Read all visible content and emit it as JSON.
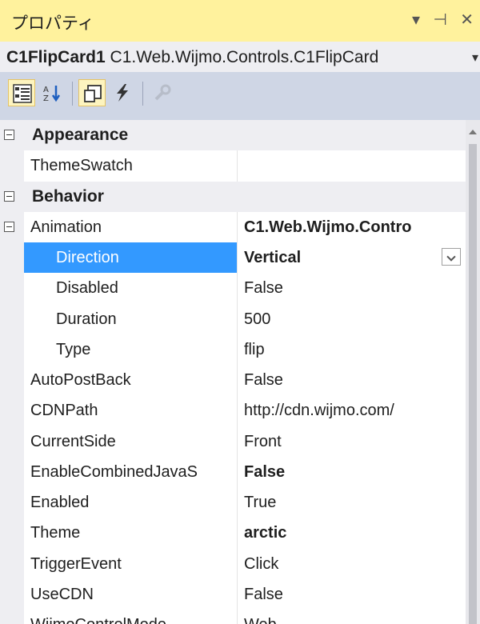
{
  "window": {
    "title": "プロパティ",
    "controls": [
      "▾",
      "⊣",
      "✕"
    ]
  },
  "object_selector": {
    "name": "C1FlipCard1",
    "type": "C1.Web.Wijmo.Controls.C1FlipCard",
    "dropdown": "▾"
  },
  "toolbar": {
    "buttons": [
      {
        "name": "categorized-icon",
        "active": true
      },
      {
        "name": "alphabetical-icon",
        "active": false
      },
      {
        "name": "properties-icon",
        "active": true
      },
      {
        "name": "events-icon",
        "active": false
      },
      {
        "name": "property-pages-icon",
        "active": false,
        "disabled": true
      }
    ]
  },
  "grid": {
    "rows": [
      {
        "kind": "category",
        "label": "Appearance"
      },
      {
        "kind": "prop",
        "name": "ThemeSwatch",
        "value": ""
      },
      {
        "kind": "category",
        "label": "Behavior"
      },
      {
        "kind": "prop",
        "name": "Animation",
        "value": "C1.Web.Wijmo.Contro",
        "bold": true,
        "expander": true
      },
      {
        "kind": "prop",
        "name": "Direction",
        "value": "Vertical",
        "bold": true,
        "indent": true,
        "selected": true,
        "dropdown": true
      },
      {
        "kind": "prop",
        "name": "Disabled",
        "value": "False",
        "indent": true
      },
      {
        "kind": "prop",
        "name": "Duration",
        "value": "500",
        "indent": true
      },
      {
        "kind": "prop",
        "name": "Type",
        "value": "flip",
        "indent": true
      },
      {
        "kind": "prop",
        "name": "AutoPostBack",
        "value": "False"
      },
      {
        "kind": "prop",
        "name": "CDNPath",
        "value": "http://cdn.wijmo.com/"
      },
      {
        "kind": "prop",
        "name": "CurrentSide",
        "value": "Front"
      },
      {
        "kind": "prop",
        "name": "EnableCombinedJavaS",
        "value": "False",
        "bold": true
      },
      {
        "kind": "prop",
        "name": "Enabled",
        "value": "True"
      },
      {
        "kind": "prop",
        "name": "Theme",
        "value": "arctic",
        "bold": true
      },
      {
        "kind": "prop",
        "name": "TriggerEvent",
        "value": "Click"
      },
      {
        "kind": "prop",
        "name": "UseCDN",
        "value": "False"
      },
      {
        "kind": "prop",
        "name": "WijmoControlMode",
        "value": "Web"
      }
    ]
  },
  "colors": {
    "title_bg": "#fff29d",
    "selection": "#3399ff",
    "toolbar_bg": "#cfd6e5"
  }
}
